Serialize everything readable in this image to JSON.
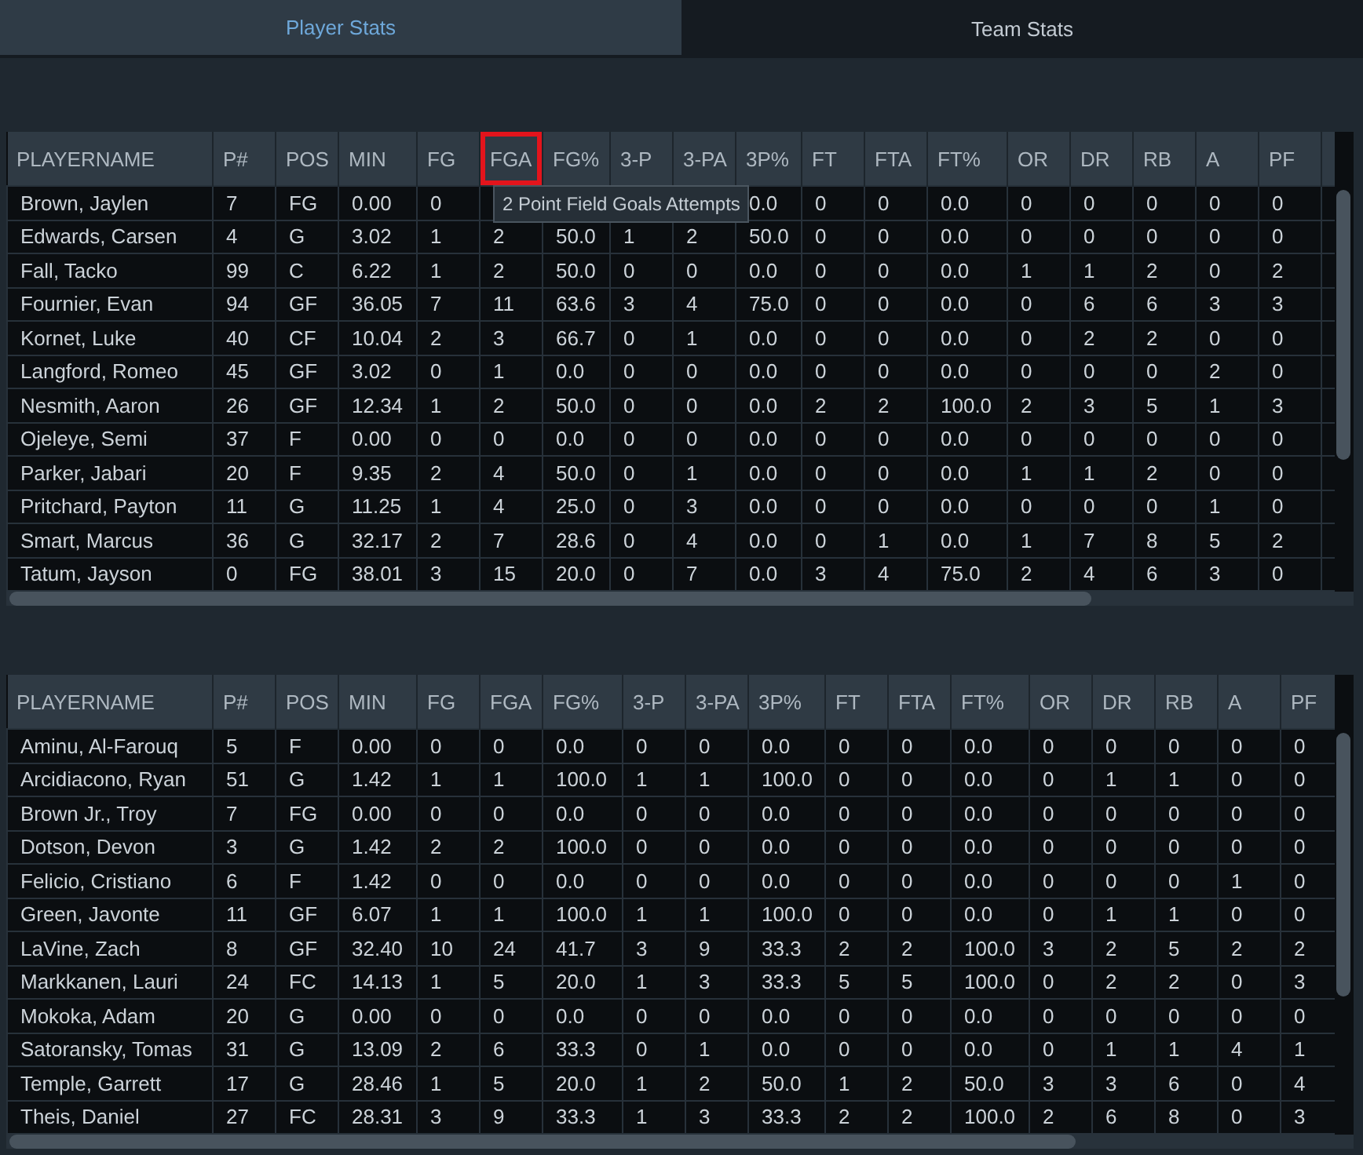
{
  "tabs": [
    {
      "label": "Player Stats",
      "selected": true
    },
    {
      "label": "Team Stats",
      "selected": false
    }
  ],
  "tables": [
    {
      "columns": [
        {
          "label": "PLAYERNAME",
          "highlighted": false
        },
        {
          "label": "P#",
          "highlighted": false
        },
        {
          "label": "POS",
          "highlighted": false
        },
        {
          "label": "MIN",
          "highlighted": false
        },
        {
          "label": "FG",
          "highlighted": false
        },
        {
          "label": "FGA",
          "highlighted": true,
          "tooltip": "2 Point Field Goals Attempts"
        },
        {
          "label": "FG%",
          "highlighted": false
        },
        {
          "label": "3-P",
          "highlighted": false
        },
        {
          "label": "3-PA",
          "highlighted": false
        },
        {
          "label": "3P%",
          "highlighted": false
        },
        {
          "label": "FT",
          "highlighted": false
        },
        {
          "label": "FTA",
          "highlighted": false
        },
        {
          "label": "FT%",
          "highlighted": false
        },
        {
          "label": "OR",
          "highlighted": false
        },
        {
          "label": "DR",
          "highlighted": false
        },
        {
          "label": "RB",
          "highlighted": false
        },
        {
          "label": "A",
          "highlighted": false
        },
        {
          "label": "PF",
          "highlighted": false
        }
      ],
      "rows": [
        [
          "Brown, Jaylen",
          "7",
          "FG",
          "0.00",
          "0",
          null,
          null,
          null,
          null,
          "0.0",
          "0",
          "0",
          "0.0",
          "0",
          "0",
          "0",
          "0",
          "0"
        ],
        [
          "Edwards, Carsen",
          "4",
          "G",
          "3.02",
          "1",
          "2",
          "50.0",
          "1",
          "2",
          "50.0",
          "0",
          "0",
          "0.0",
          "0",
          "0",
          "0",
          "0",
          "0"
        ],
        [
          "Fall, Tacko",
          "99",
          "C",
          "6.22",
          "1",
          "2",
          "50.0",
          "0",
          "0",
          "0.0",
          "0",
          "0",
          "0.0",
          "1",
          "1",
          "2",
          "0",
          "2"
        ],
        [
          "Fournier, Evan",
          "94",
          "GF",
          "36.05",
          "7",
          "11",
          "63.6",
          "3",
          "4",
          "75.0",
          "0",
          "0",
          "0.0",
          "0",
          "6",
          "6",
          "3",
          "3"
        ],
        [
          "Kornet, Luke",
          "40",
          "CF",
          "10.04",
          "2",
          "3",
          "66.7",
          "0",
          "1",
          "0.0",
          "0",
          "0",
          "0.0",
          "0",
          "2",
          "2",
          "0",
          "0"
        ],
        [
          "Langford, Romeo",
          "45",
          "GF",
          "3.02",
          "0",
          "1",
          "0.0",
          "0",
          "0",
          "0.0",
          "0",
          "0",
          "0.0",
          "0",
          "0",
          "0",
          "2",
          "0"
        ],
        [
          "Nesmith, Aaron",
          "26",
          "GF",
          "12.34",
          "1",
          "2",
          "50.0",
          "0",
          "0",
          "0.0",
          "2",
          "2",
          "100.0",
          "2",
          "3",
          "5",
          "1",
          "3"
        ],
        [
          "Ojeleye, Semi",
          "37",
          "F",
          "0.00",
          "0",
          "0",
          "0.0",
          "0",
          "0",
          "0.0",
          "0",
          "0",
          "0.0",
          "0",
          "0",
          "0",
          "0",
          "0"
        ],
        [
          "Parker, Jabari",
          "20",
          "F",
          "9.35",
          "2",
          "4",
          "50.0",
          "0",
          "1",
          "0.0",
          "0",
          "0",
          "0.0",
          "1",
          "1",
          "2",
          "0",
          "0"
        ],
        [
          "Pritchard, Payton",
          "11",
          "G",
          "11.25",
          "1",
          "4",
          "25.0",
          "0",
          "3",
          "0.0",
          "0",
          "0",
          "0.0",
          "0",
          "0",
          "0",
          "1",
          "0"
        ],
        [
          "Smart, Marcus",
          "36",
          "G",
          "32.17",
          "2",
          "7",
          "28.6",
          "0",
          "4",
          "0.0",
          "0",
          "1",
          "0.0",
          "1",
          "7",
          "8",
          "5",
          "2"
        ],
        [
          "Tatum, Jayson",
          "0",
          "FG",
          "38.01",
          "3",
          "15",
          "20.0",
          "0",
          "7",
          "0.0",
          "3",
          "4",
          "75.0",
          "2",
          "4",
          "6",
          "3",
          "0"
        ]
      ]
    },
    {
      "columns": [
        {
          "label": "PLAYERNAME",
          "highlighted": false
        },
        {
          "label": "P#",
          "highlighted": false
        },
        {
          "label": "POS",
          "highlighted": false
        },
        {
          "label": "MIN",
          "highlighted": false
        },
        {
          "label": "FG",
          "highlighted": false
        },
        {
          "label": "FGA",
          "highlighted": false
        },
        {
          "label": "FG%",
          "highlighted": false
        },
        {
          "label": "3-P",
          "highlighted": false
        },
        {
          "label": "3-PA",
          "highlighted": false
        },
        {
          "label": "3P%",
          "highlighted": false
        },
        {
          "label": "FT",
          "highlighted": false
        },
        {
          "label": "FTA",
          "highlighted": false
        },
        {
          "label": "FT%",
          "highlighted": false
        },
        {
          "label": "OR",
          "highlighted": false
        },
        {
          "label": "DR",
          "highlighted": false
        },
        {
          "label": "RB",
          "highlighted": false
        },
        {
          "label": "A",
          "highlighted": false
        },
        {
          "label": "PF",
          "highlighted": false
        }
      ],
      "rows": [
        [
          "Aminu, Al-Farouq",
          "5",
          "F",
          "0.00",
          "0",
          "0",
          "0.0",
          "0",
          "0",
          "0.0",
          "0",
          "0",
          "0.0",
          "0",
          "0",
          "0",
          "0",
          "0"
        ],
        [
          "Arcidiacono, Ryan",
          "51",
          "G",
          "1.42",
          "1",
          "1",
          "100.0",
          "1",
          "1",
          "100.0",
          "0",
          "0",
          "0.0",
          "0",
          "1",
          "1",
          "0",
          "0"
        ],
        [
          "Brown Jr., Troy",
          "7",
          "FG",
          "0.00",
          "0",
          "0",
          "0.0",
          "0",
          "0",
          "0.0",
          "0",
          "0",
          "0.0",
          "0",
          "0",
          "0",
          "0",
          "0"
        ],
        [
          "Dotson, Devon",
          "3",
          "G",
          "1.42",
          "2",
          "2",
          "100.0",
          "0",
          "0",
          "0.0",
          "0",
          "0",
          "0.0",
          "0",
          "0",
          "0",
          "0",
          "0"
        ],
        [
          "Felicio, Cristiano",
          "6",
          "F",
          "1.42",
          "0",
          "0",
          "0.0",
          "0",
          "0",
          "0.0",
          "0",
          "0",
          "0.0",
          "0",
          "0",
          "0",
          "1",
          "0"
        ],
        [
          "Green, Javonte",
          "11",
          "GF",
          "6.07",
          "1",
          "1",
          "100.0",
          "1",
          "1",
          "100.0",
          "0",
          "0",
          "0.0",
          "0",
          "1",
          "1",
          "0",
          "0"
        ],
        [
          "LaVine, Zach",
          "8",
          "GF",
          "32.40",
          "10",
          "24",
          "41.7",
          "3",
          "9",
          "33.3",
          "2",
          "2",
          "100.0",
          "3",
          "2",
          "5",
          "2",
          "2"
        ],
        [
          "Markkanen, Lauri",
          "24",
          "FC",
          "14.13",
          "1",
          "5",
          "20.0",
          "1",
          "3",
          "33.3",
          "5",
          "5",
          "100.0",
          "0",
          "2",
          "2",
          "0",
          "3"
        ],
        [
          "Mokoka, Adam",
          "20",
          "G",
          "0.00",
          "0",
          "0",
          "0.0",
          "0",
          "0",
          "0.0",
          "0",
          "0",
          "0.0",
          "0",
          "0",
          "0",
          "0",
          "0"
        ],
        [
          "Satoransky, Tomas",
          "31",
          "G",
          "13.09",
          "2",
          "6",
          "33.3",
          "0",
          "1",
          "0.0",
          "0",
          "0",
          "0.0",
          "0",
          "1",
          "1",
          "4",
          "1"
        ],
        [
          "Temple, Garrett",
          "17",
          "G",
          "28.46",
          "1",
          "5",
          "20.0",
          "1",
          "2",
          "50.0",
          "1",
          "2",
          "50.0",
          "3",
          "3",
          "6",
          "0",
          "4"
        ],
        [
          "Theis, Daniel",
          "27",
          "FC",
          "28.31",
          "3",
          "9",
          "33.3",
          "1",
          "3",
          "33.3",
          "2",
          "2",
          "100.0",
          "2",
          "6",
          "8",
          "0",
          "3"
        ]
      ]
    }
  ]
}
